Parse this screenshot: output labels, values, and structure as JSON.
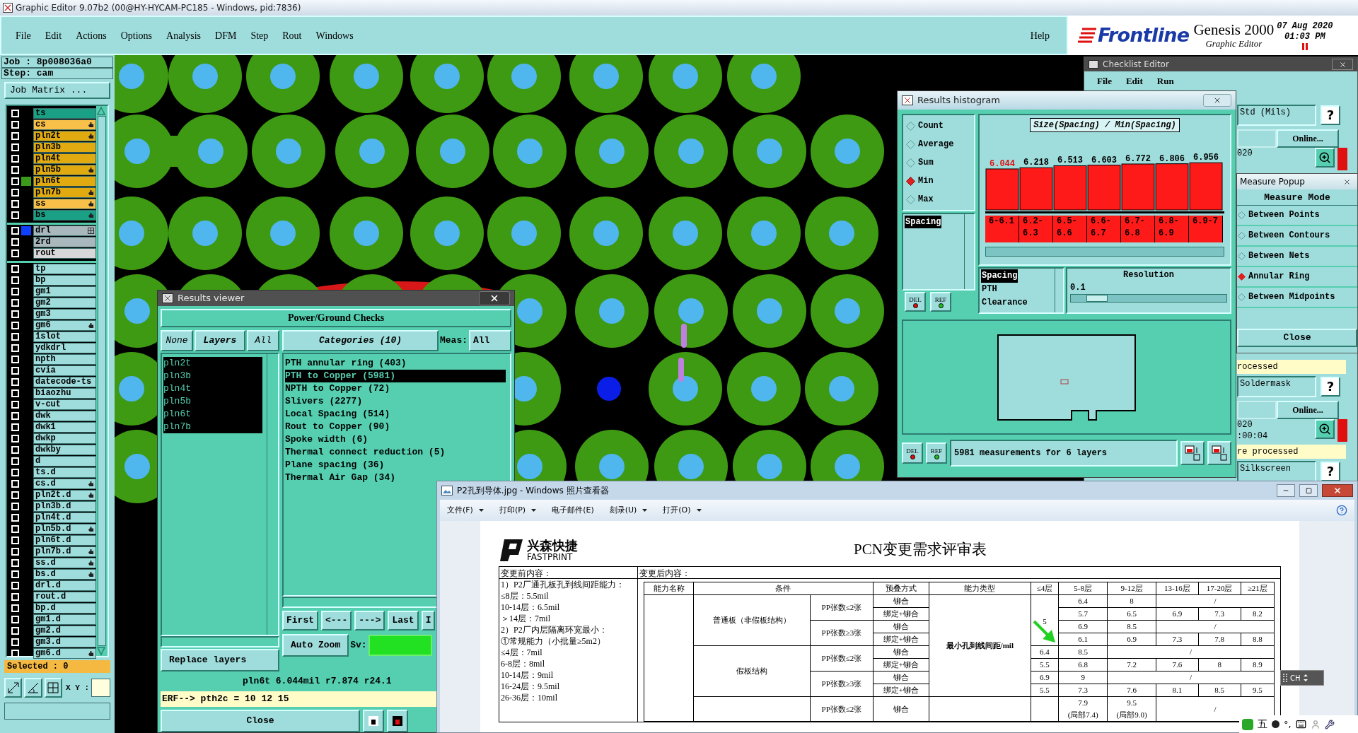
{
  "window": {
    "title": "Graphic Editor 9.07b2 (00@HY-HYCAM-PC185 - Windows, pid:7836)"
  },
  "menu": [
    "File",
    "Edit",
    "Actions",
    "Options",
    "Analysis",
    "DFM",
    "Step",
    "Rout",
    "Windows"
  ],
  "help": "Help",
  "brand": {
    "logo": "Frontline",
    "product": "Genesis 2000",
    "subtitle": "Graphic Editor",
    "date": "07 Aug 2020",
    "time": "01:03 PM"
  },
  "job_panel": {
    "job": "Job : 8p008036a0",
    "step": "Step: cam",
    "matrix_button": "Job Matrix ...",
    "layer_groups": [
      [
        {
          "name": "ts",
          "color": "#1aa084",
          "kind": "plain",
          "checked": false
        },
        {
          "name": "cs",
          "color": "#f8c048",
          "kind": "hand",
          "checked": false
        },
        {
          "name": "pln2t",
          "color": "#e0aa10",
          "kind": "hand",
          "checked": false
        },
        {
          "name": "pln3b",
          "color": "#e0aa10",
          "kind": "plain",
          "checked": false
        },
        {
          "name": "pln4t",
          "color": "#e0aa10",
          "kind": "plain",
          "checked": false
        },
        {
          "name": "pln5b",
          "color": "#e0aa10",
          "kind": "hand",
          "checked": false
        },
        {
          "name": "pln6t",
          "color": "#e0aa10",
          "kind": "plain",
          "checked": false,
          "indicator": {
            "color": "#3c9a1a"
          }
        },
        {
          "name": "pln7b",
          "color": "#e0aa10",
          "kind": "hand",
          "checked": false
        },
        {
          "name": "ss",
          "color": "#f8c048",
          "kind": "hand",
          "checked": false
        },
        {
          "name": "bs",
          "color": "#1aa084",
          "kind": "hand",
          "checked": false
        }
      ],
      [
        {
          "name": "drl",
          "color": "#a8b8bc",
          "kind": "grid",
          "checked": false,
          "indicator": {
            "color": "#1040ff"
          }
        },
        {
          "name": "2rd",
          "color": "#a8b8bc",
          "kind": "plain",
          "checked": false
        },
        {
          "name": "rout",
          "color": "#d8d8d8",
          "kind": "plain",
          "checked": false
        }
      ],
      [
        {
          "name": "tp",
          "color": "#9fdcdc",
          "kind": "plain",
          "checked": false
        },
        {
          "name": "bp",
          "color": "#9fdcdc",
          "kind": "plain",
          "checked": false
        },
        {
          "name": "gm1",
          "color": "#9fdcdc",
          "kind": "plain",
          "checked": false
        },
        {
          "name": "gm2",
          "color": "#9fdcdc",
          "kind": "plain",
          "checked": false
        },
        {
          "name": "gm3",
          "color": "#9fdcdc",
          "kind": "plain",
          "checked": false
        },
        {
          "name": "gm6",
          "color": "#9fdcdc",
          "kind": "hand",
          "checked": false
        },
        {
          "name": "1slot",
          "color": "#9fdcdc",
          "kind": "plain",
          "checked": false
        },
        {
          "name": "ydkdrl",
          "color": "#9fdcdc",
          "kind": "plain",
          "checked": false
        },
        {
          "name": "npth",
          "color": "#9fdcdc",
          "kind": "plain",
          "checked": false
        },
        {
          "name": "cvia",
          "color": "#9fdcdc",
          "kind": "plain",
          "checked": false
        },
        {
          "name": "datecode-ts",
          "color": "#9fdcdc",
          "kind": "plain",
          "checked": false
        },
        {
          "name": "biaozhu",
          "color": "#9fdcdc",
          "kind": "plain",
          "checked": false
        },
        {
          "name": "v-cut",
          "color": "#9fdcdc",
          "kind": "plain",
          "checked": false
        },
        {
          "name": "dwk",
          "color": "#9fdcdc",
          "kind": "plain",
          "checked": false
        },
        {
          "name": "dwk1",
          "color": "#9fdcdc",
          "kind": "plain",
          "checked": false
        },
        {
          "name": "dwkp",
          "color": "#9fdcdc",
          "kind": "plain",
          "checked": false
        },
        {
          "name": "dwkby",
          "color": "#9fdcdc",
          "kind": "plain",
          "checked": false
        },
        {
          "name": "d",
          "color": "#9fdcdc",
          "kind": "plain",
          "checked": false
        },
        {
          "name": "ts.d",
          "color": "#9fdcdc",
          "kind": "plain",
          "checked": false
        },
        {
          "name": "cs.d",
          "color": "#9fdcdc",
          "kind": "hand",
          "checked": false
        },
        {
          "name": "pln2t.d",
          "color": "#9fdcdc",
          "kind": "hand",
          "checked": false
        },
        {
          "name": "pln3b.d",
          "color": "#9fdcdc",
          "kind": "plain",
          "checked": false
        },
        {
          "name": "pln4t.d",
          "color": "#9fdcdc",
          "kind": "plain",
          "checked": false
        },
        {
          "name": "pln5b.d",
          "color": "#9fdcdc",
          "kind": "hand",
          "checked": false
        },
        {
          "name": "pln6t.d",
          "color": "#9fdcdc",
          "kind": "plain",
          "checked": false
        },
        {
          "name": "pln7b.d",
          "color": "#9fdcdc",
          "kind": "hand",
          "checked": false
        },
        {
          "name": "ss.d",
          "color": "#9fdcdc",
          "kind": "hand",
          "checked": false
        },
        {
          "name": "bs.d",
          "color": "#9fdcdc",
          "kind": "hand",
          "checked": false
        },
        {
          "name": "drl.d",
          "color": "#9fdcdc",
          "kind": "plain",
          "checked": false
        },
        {
          "name": "rout.d",
          "color": "#9fdcdc",
          "kind": "plain",
          "checked": false
        },
        {
          "name": "bp.d",
          "color": "#9fdcdc",
          "kind": "plain",
          "checked": false
        },
        {
          "name": "gm1.d",
          "color": "#9fdcdc",
          "kind": "plain",
          "checked": false
        },
        {
          "name": "gm2.d",
          "color": "#9fdcdc",
          "kind": "plain",
          "checked": false
        },
        {
          "name": "gm3.d",
          "color": "#9fdcdc",
          "kind": "plain",
          "checked": false
        },
        {
          "name": "gm6.d",
          "color": "#9fdcdc",
          "kind": "hand",
          "checked": false
        }
      ]
    ],
    "selected_count": "Selected : 0",
    "xy_label": "X Y :"
  },
  "results_viewer": {
    "title": "Results viewer",
    "header": "Power/Ground Checks",
    "layer_buttons": [
      {
        "label": "None",
        "kind": "option"
      },
      {
        "label": "Layers",
        "kind": "heading"
      },
      {
        "label": "All",
        "kind": "option"
      }
    ],
    "layers": [
      {
        "name": "pln2t",
        "selected": true
      },
      {
        "name": "pln3b",
        "selected": true
      },
      {
        "name": "pln4t",
        "selected": true
      },
      {
        "name": "pln5b",
        "selected": true
      },
      {
        "name": "pln6t",
        "selected": true
      },
      {
        "name": "pln7b",
        "selected": true
      }
    ],
    "categories_title": "Categories (10)",
    "meas_label": "Meas:",
    "meas_value": "All",
    "categories": [
      {
        "label": "PTH annular ring (403)",
        "selected": false
      },
      {
        "label": "PTH to Copper (5981)",
        "selected": true
      },
      {
        "label": "NPTH to Copper (72)",
        "selected": false
      },
      {
        "label": "Slivers (2277)",
        "selected": false
      },
      {
        "label": "Local Spacing (514)",
        "selected": false
      },
      {
        "label": "Rout to Copper (90)",
        "selected": false
      },
      {
        "label": "Spoke width (6)",
        "selected": false
      },
      {
        "label": "Thermal connect reduction (5)",
        "selected": false
      },
      {
        "label": "Plane spacing (36)",
        "selected": false
      },
      {
        "label": "Thermal Air Gap (34)",
        "selected": false
      }
    ],
    "nav_buttons": [
      "First",
      "<---",
      "--->",
      "Last",
      "I"
    ],
    "zoom_menu": "Auto Zoom",
    "sv_label": "Sv:",
    "replace_menu": "Replace layers",
    "status": "pln6t 6.044mil r7.874 r24.1",
    "erf": "ERF--> pth2c = 10 12 15",
    "close": "Close"
  },
  "histogram": {
    "title": "Results histogram",
    "modes": [
      {
        "label": "Count",
        "selected": false
      },
      {
        "label": "Average",
        "selected": false
      },
      {
        "label": "Sum",
        "selected": false
      },
      {
        "label": "Min",
        "selected": true
      },
      {
        "label": "Max",
        "selected": false
      }
    ],
    "measures": [
      {
        "label": "Spacing",
        "selected": true
      }
    ],
    "list_buttons": [
      {
        "label": "DEL",
        "kind": "delete"
      },
      {
        "label": "REF",
        "kind": "reference"
      }
    ],
    "chart_data": {
      "type": "bar",
      "title": "Size(Spacing) / Min(Spacing)",
      "categories": [
        "6-6.1",
        "6.2-6.3",
        "6.5-6.6",
        "6.6-6.7",
        "6.7-6.8",
        "6.8-6.9",
        "6.9-7"
      ],
      "series": [
        {
          "color": "#ff1a1a",
          "values": [
            6.044,
            6.218,
            6.513,
            6.603,
            6.772,
            6.806,
            6.956
          ]
        }
      ],
      "data_labels": true
    },
    "properties": [
      {
        "label": "Spacing",
        "selected": true
      },
      {
        "label": "PTH",
        "selected": false
      },
      {
        "label": "Clearance",
        "selected": false
      }
    ],
    "resolution": {
      "label": "Resolution",
      "value": "0.1",
      "level": 0.1
    },
    "summary_buttons": [
      {
        "label": "DEL",
        "kind": "delete"
      },
      {
        "label": "REF",
        "kind": "reference"
      }
    ],
    "summary": "5981 measurements for 6 layers"
  },
  "checklist_editor": {
    "title": "Checklist Editor",
    "menu": [
      "File",
      "Edit",
      "Run"
    ],
    "top_rows": [
      {
        "kind": "field",
        "text": "Std (Mils)",
        "help": "?"
      },
      {
        "kind": "button",
        "text": "Online..."
      },
      {
        "kind": "timing",
        "lines": [
          "020"
        ]
      }
    ],
    "bottom_rows": [
      {
        "kind": "status",
        "text": "rocessed"
      },
      {
        "kind": "field",
        "text": "Soldermask",
        "help": "?"
      },
      {
        "kind": "button",
        "text": "Online..."
      },
      {
        "kind": "timing",
        "lines": [
          "020",
          ":00:04"
        ]
      },
      {
        "kind": "status",
        "text": "re processed"
      },
      {
        "kind": "field",
        "text": "Silkscreen",
        "help": "?"
      }
    ]
  },
  "measure_popup": {
    "title": "Measure Popup",
    "heading": "Measure Mode",
    "modes": [
      {
        "label": "Between Points",
        "selected": false
      },
      {
        "label": "Between Contours",
        "selected": false
      },
      {
        "label": "Between Nets",
        "selected": false
      },
      {
        "label": "Annular Ring",
        "selected": true
      },
      {
        "label": "Between Midpoints",
        "selected": false
      }
    ],
    "close": "Close"
  },
  "photo_viewer": {
    "title": "P2孔到导体.jpg - Windows 照片查看器",
    "menu": [
      {
        "label": "文件(F)",
        "dropdown": true
      },
      {
        "label": "打印(P)",
        "dropdown": true
      },
      {
        "label": "电子邮件(E)",
        "dropdown": false
      },
      {
        "label": "刻录(U)",
        "dropdown": true
      },
      {
        "label": "打开(O)",
        "dropdown": true
      }
    ],
    "document": {
      "logo_cn": "兴森快捷",
      "logo_en": "FASTPRINT",
      "title": "PCN变更需求评审表",
      "before_label": "变更前内容：",
      "after_label": "变更后内容：",
      "before_lines": [
        "1）P2厂通孔板孔到线间距能力：",
        "≤8层：5.5mil",
        "10-14层：6.5mil",
        "＞14层：7mil",
        "2）P2厂内层隔离环宽最小：",
        "①常规能力（小批量≥5m2）",
        "≤4层：7mil",
        "6-8层：8mil",
        "10-14层：9mil",
        "16-24层：9.5mil",
        "26-36层：10mil"
      ],
      "table": {
        "columns": [
          {
            "label": "能力名称",
            "kind": "single"
          },
          {
            "label": "条件",
            "kind": "pair"
          },
          {
            "label": "预叠方式",
            "kind": "single"
          },
          {
            "label": "能力类型",
            "kind": "single"
          },
          {
            "label": "≤4层",
            "kind": "single"
          },
          {
            "label": "5-8层",
            "kind": "single"
          },
          {
            "label": "9-12层",
            "kind": "single"
          },
          {
            "label": "13-16层",
            "kind": "single"
          },
          {
            "label": "17-20层",
            "kind": "single"
          },
          {
            "label": "≥21层",
            "kind": "single"
          }
        ],
        "type": "最小孔到线间距/mil",
        "groups": [
          {
            "label": "普通板（非假板结构）",
            "le4": "5",
            "kind": "full",
            "children": [
              {
                "label": "PP张数≤2张",
                "children": [
                  {
                    "method": "铆合",
                    "values": [
                      "6.4",
                      "8",
                      "/"
                    ]
                  },
                  {
                    "method": "绑定+铆合",
                    "values": [
                      "5.7",
                      "6.5",
                      "6.9",
                      "7.3",
                      "8.2"
                    ]
                  }
                ]
              },
              {
                "label": "PP张数≥3张",
                "children": [
                  {
                    "method": "铆合",
                    "values": [
                      "6.9",
                      "8.5",
                      "/"
                    ]
                  },
                  {
                    "method": "绑定+铆合",
                    "values": [
                      "6.1",
                      "6.9",
                      "7.3",
                      "7.8",
                      "8.8"
                    ]
                  }
                ]
              }
            ]
          },
          {
            "label": "假板结构",
            "kind": "full",
            "children": [
              {
                "label": "PP张数≤2张",
                "children": [
                  {
                    "method": "铆合",
                    "values": [
                      "6.4",
                      "8.5",
                      "/"
                    ]
                  },
                  {
                    "method": "绑定+铆合",
                    "values": [
                      "5.5",
                      "6.8",
                      "7.2",
                      "7.6",
                      "8",
                      "8.9"
                    ]
                  }
                ]
              },
              {
                "label": "PP张数≥3张",
                "children": [
                  {
                    "method": "铆合",
                    "values": [
                      "6.9",
                      "9",
                      "/"
                    ]
                  },
                  {
                    "method": "绑定+铆合",
                    "values": [
                      "5.5",
                      "7.3",
                      "7.6",
                      "8.1",
                      "8.5",
                      "9.5"
                    ]
                  }
                ]
              }
            ]
          },
          {
            "kind": "cut",
            "children": [
              {
                "label": "PP张数≤2张",
                "children": [
                  {
                    "method": "铆合",
                    "values": [
                      "7.9",
                      "9.5",
                      "/"
                    ],
                    "notes": [
                      "(局部7.4)",
                      "(局部9.0)"
                    ]
                  }
                ]
              }
            ]
          }
        ]
      }
    }
  },
  "input_method": {
    "label": "CH"
  },
  "tray": {
    "label": "五",
    "punct": "°,"
  }
}
